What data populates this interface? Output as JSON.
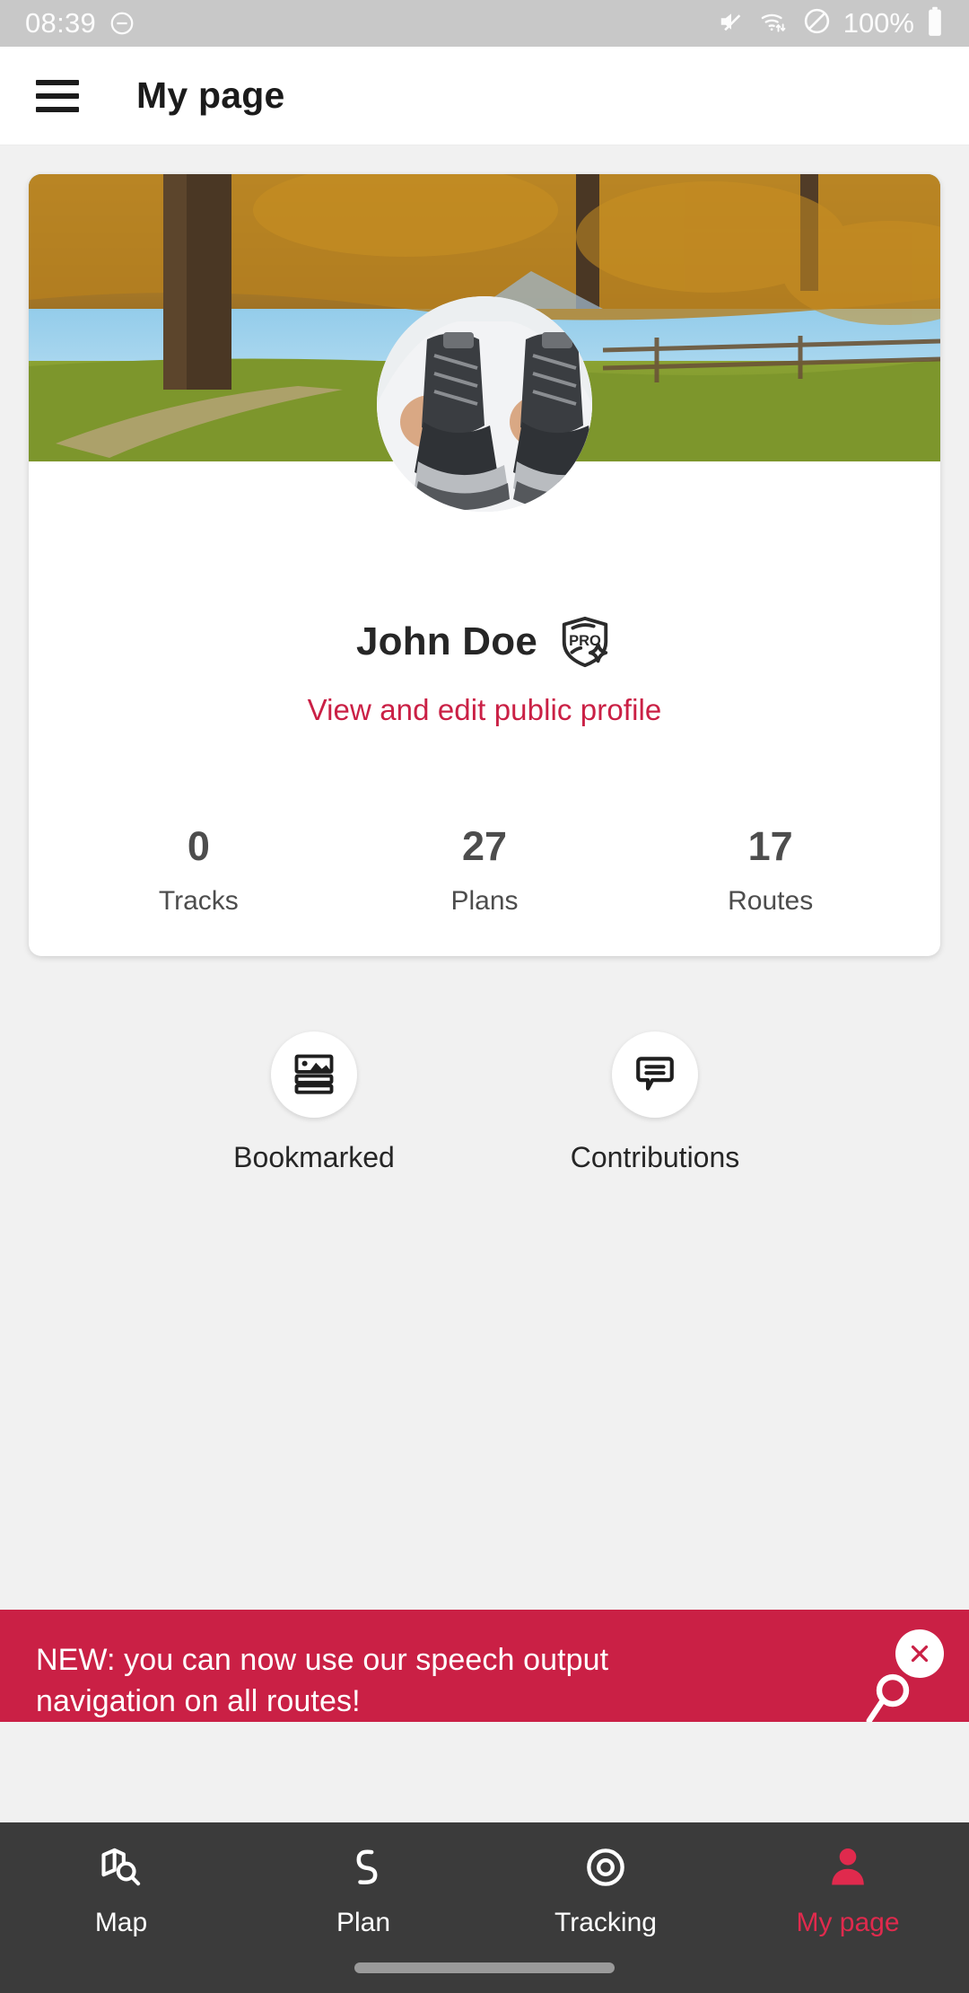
{
  "statusbar": {
    "time": "08:39",
    "battery_percent": "100%",
    "icons": [
      "do-not-disturb-icon",
      "volume-mute-icon",
      "wifi-icon",
      "dnd-block-icon",
      "battery-icon"
    ]
  },
  "appbar": {
    "menu_icon": "hamburger-menu-icon",
    "title": "My page"
  },
  "profile": {
    "name": "John Doe",
    "badge_label": "PRO",
    "edit_link": "View and edit public profile",
    "stats": [
      {
        "value": "0",
        "label": "Tracks"
      },
      {
        "value": "27",
        "label": "Plans"
      },
      {
        "value": "17",
        "label": "Routes"
      }
    ]
  },
  "quick_actions": [
    {
      "label": "Bookmarked",
      "icon": "bookmarked-list-icon"
    },
    {
      "label": "Contributions",
      "icon": "speech-bubble-icon"
    }
  ],
  "banner": {
    "text": "NEW: you can now use our speech output navigation on all routes!",
    "close_icon": "close-icon",
    "accent": "#ca2045"
  },
  "bottom_nav": {
    "items": [
      {
        "label": "Map",
        "icon": "map-search-icon",
        "active": false
      },
      {
        "label": "Plan",
        "icon": "route-path-icon",
        "active": false
      },
      {
        "label": "Tracking",
        "icon": "target-icon",
        "active": false
      },
      {
        "label": "My page",
        "icon": "person-icon",
        "active": true
      }
    ],
    "active_color": "#e02a4d"
  }
}
